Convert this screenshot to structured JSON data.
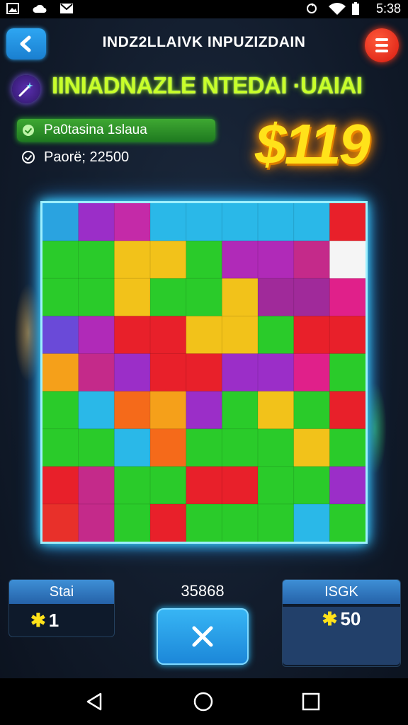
{
  "status_bar": {
    "left_icons": [
      "image-icon",
      "cloud-icon",
      "mail-icon"
    ],
    "right_icons": [
      "sync-icon",
      "wifi-icon",
      "battery-icon"
    ],
    "time": "5:38"
  },
  "header": {
    "title": "INDZ2LLAIVK INPUZIZDAIN",
    "back_icon": "chevron-left-icon",
    "menu_icon": "menu-icon"
  },
  "level": {
    "icon": "puzzle-wand-icon",
    "title": "IINIADNAZLE NTEDAI ·UAIAI"
  },
  "progress": {
    "label": "Pa0tasina 1slaua",
    "icon": "check-icon"
  },
  "points": {
    "label": "Paorë; 22500",
    "icon": "check-circle-icon"
  },
  "money": "$119",
  "board": {
    "rows": 9,
    "cols": 9,
    "tiles": [
      "#2aa3e0",
      "#9b2ec8",
      "#c42aa8",
      "#2ab8e8",
      "#2ab8e8",
      "#2ab8e8",
      "#2ab8e8",
      "#2ab8e8",
      "#e8202a",
      "#2acb2a",
      "#2acb2a",
      "#f2c21a",
      "#f2c21a",
      "#2acb2a",
      "#b02ab8",
      "#b02ab8",
      "#c42a8a",
      "#f5f5f5",
      "#2acb2a",
      "#2acb2a",
      "#f2c21a",
      "#2acb2a",
      "#2acb2a",
      "#f2c21a",
      "#a02a9a",
      "#a02a9a",
      "#e0208a",
      "#6a4ad8",
      "#b02ab8",
      "#e8202a",
      "#e8202a",
      "#f2c21a",
      "#f2c21a",
      "#2acb2a",
      "#e8202a",
      "#e8202a",
      "#f5a01a",
      "#c42a8a",
      "#9b2ec8",
      "#e8202a",
      "#e8202a",
      "#9b2ec8",
      "#9b2ec8",
      "#e0208a",
      "#2acb2a",
      "#2acb2a",
      "#2ab8e8",
      "#f56a1a",
      "#f5a01a",
      "#9b2ec8",
      "#2acb2a",
      "#f2c21a",
      "#2acb2a",
      "#e8202a",
      "#2acb2a",
      "#2acb2a",
      "#2ab8e8",
      "#f56a1a",
      "#2acb2a",
      "#2acb2a",
      "#2acb2a",
      "#f2c21a",
      "#2acb2a",
      "#e8202a",
      "#c42a8a",
      "#2acb2a",
      "#2acb2a",
      "#e8202a",
      "#e8202a",
      "#2acb2a",
      "#2acb2a",
      "#9b2ec8",
      "#e8302a",
      "#c42a8a",
      "#2acb2a",
      "#e8202a",
      "#2acb2a",
      "#2acb2a",
      "#2acb2a",
      "#2ab8e8",
      "#2acb2a"
    ]
  },
  "bottom": {
    "left_box": {
      "header": "Stai",
      "value": "1",
      "icon": "star-icon"
    },
    "center_label": "35868",
    "close_icon": "close-icon",
    "right_box": {
      "header": "ISGK",
      "value": "50",
      "icon": "star-icon"
    }
  },
  "nav": {
    "back_icon": "nav-back-icon",
    "home_icon": "nav-home-icon",
    "recents_icon": "nav-recents-icon"
  }
}
